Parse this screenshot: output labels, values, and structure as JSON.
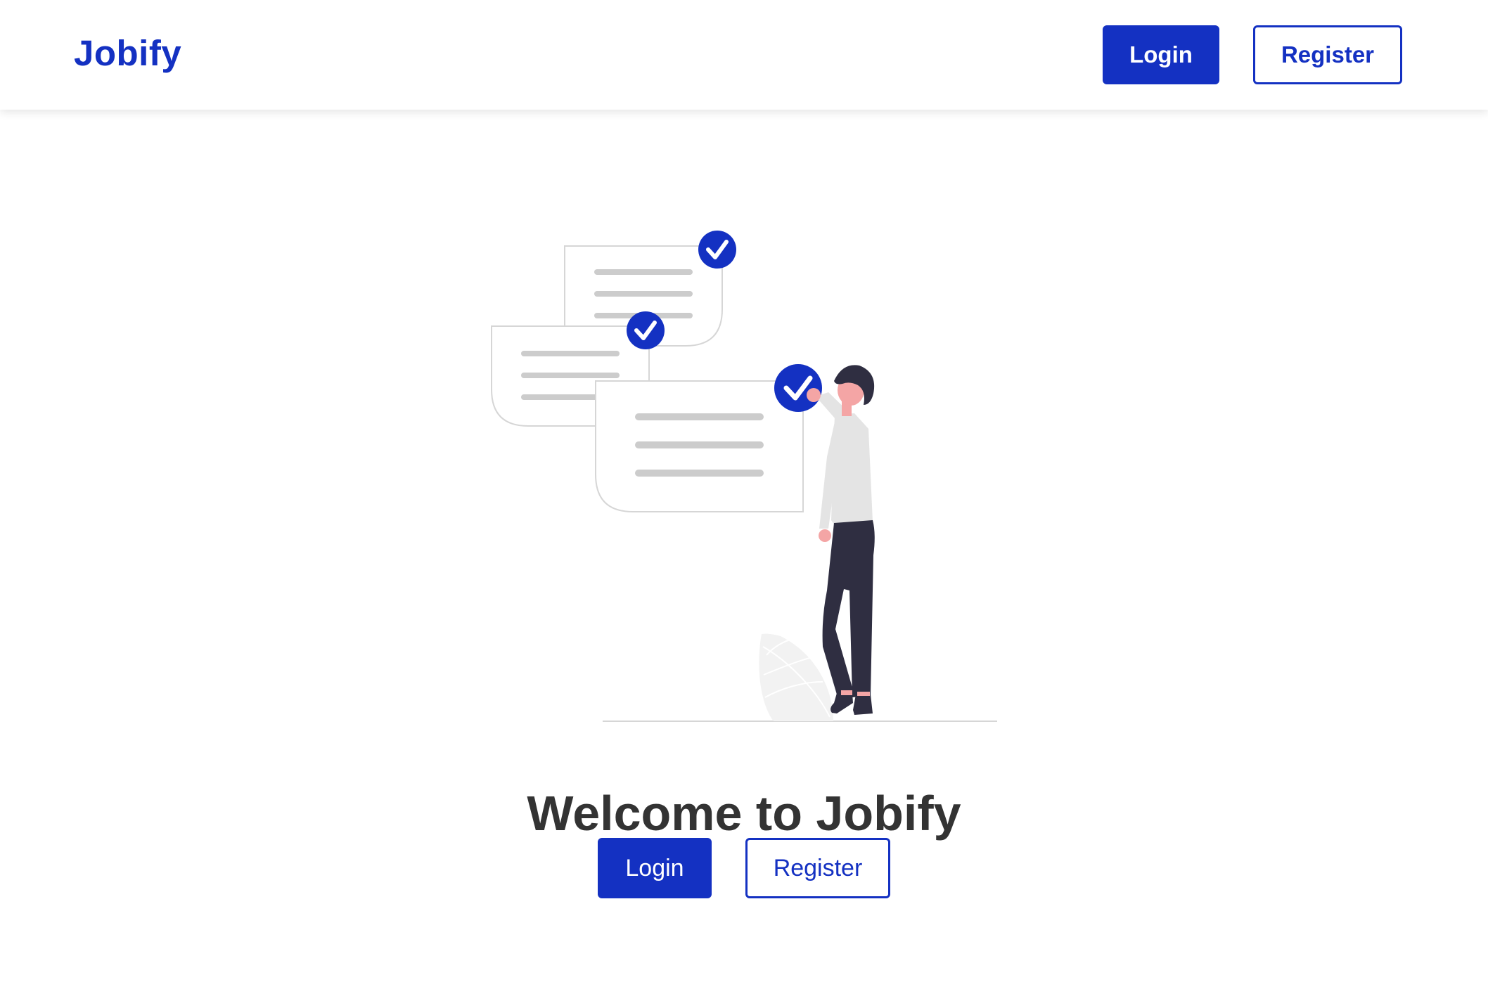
{
  "navbar": {
    "brand": "Jobify",
    "login_label": "Login",
    "register_label": "Register"
  },
  "hero": {
    "headline": "Welcome to Jobify",
    "login_label": "Login",
    "register_label": "Register",
    "illustration_icon": "person-checking-documents-illustration"
  },
  "colors": {
    "accent": "#1431c2",
    "heading": "#333333",
    "background": "#ffffff"
  }
}
